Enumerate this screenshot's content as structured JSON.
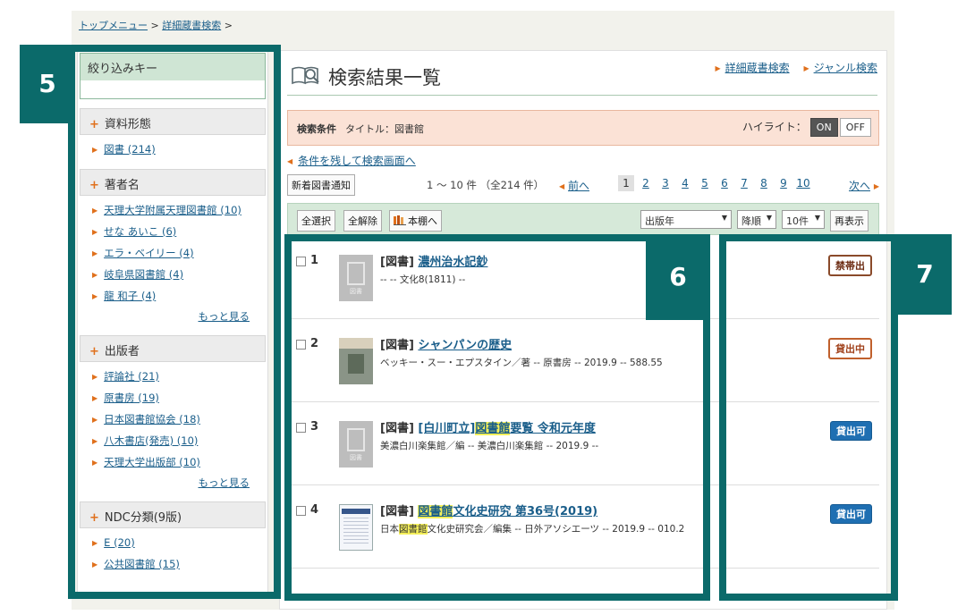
{
  "breadcrumb": {
    "top": "トップメニュー",
    "sep": ">",
    "detail": "詳細蔵書検索",
    "sep2": ">"
  },
  "sidebar": {
    "key_title": "絞り込みキー",
    "facets": [
      {
        "title": "資料形態",
        "items": [
          "図書 (214)"
        ]
      },
      {
        "title": "著者名",
        "items": [
          "天理大学附属天理図書館 (10)",
          "せな あいこ (6)",
          "エラ・ベイリー (4)",
          "岐阜県図書館 (4)",
          "龍 和子 (4)"
        ],
        "more": "もっと見る"
      },
      {
        "title": "出版者",
        "items": [
          "評論社 (21)",
          "原書房 (19)",
          "日本図書館協会 (18)",
          "八木書店(発売) (10)",
          "天理大学出版部 (10)"
        ],
        "more": "もっと見る"
      },
      {
        "title": "NDC分類(9版)",
        "items": [
          "E (20)",
          "公共図書館 (15)"
        ]
      }
    ]
  },
  "main": {
    "title": "検索結果一覧",
    "links": [
      "詳細蔵書検索",
      "ジャンル検索"
    ],
    "condition": {
      "label": "検索条件",
      "value": "タイトル：図書館",
      "highlight_label": "ハイライト：",
      "on": "ON",
      "off": "OFF"
    },
    "back_link": "条件を残して検索画面へ",
    "new_arrival_button": "新着図書通知",
    "count": "1 ～ 10 件 （全214 件）",
    "prev": "前へ",
    "pages": [
      "1",
      "2",
      "3",
      "4",
      "5",
      "6",
      "7",
      "8",
      "9",
      "10"
    ],
    "current_page": "1",
    "next": "次へ",
    "toolbar": {
      "select_all": "全選択",
      "deselect_all": "全解除",
      "shelf": "本棚へ",
      "sort_field": "出版年",
      "sort_order": "降順",
      "per_page": "10件",
      "redisplay": "再表示"
    },
    "results": [
      {
        "num": "1",
        "type": "[図書]",
        "title_parts": [
          {
            "t": "濃州治水記鈔",
            "hl": false
          }
        ],
        "meta": "-- -- 文化8(1811) --",
        "thumb": "図書",
        "status": "禁帯出",
        "status_kind": "ban"
      },
      {
        "num": "2",
        "type": "[図書]",
        "title_parts": [
          {
            "t": "シャンパンの歴史",
            "hl": false
          }
        ],
        "meta": "ベッキー・スー・エプスタイン／著 -- 原書房 -- 2019.9 -- 588.55",
        "thumb": "",
        "status": "貸出中",
        "status_kind": "out"
      },
      {
        "num": "3",
        "type": "[図書]",
        "title_parts": [
          {
            "t": "[白川町立]",
            "hl": false
          },
          {
            "t": "図書館",
            "hl": true
          },
          {
            "t": "要覧 令和元年度",
            "hl": false
          }
        ],
        "meta": "美濃白川楽集館／編 -- 美濃白川楽集館 -- 2019.9 --",
        "thumb": "図書",
        "status": "貸出可",
        "status_kind": "ok"
      },
      {
        "num": "4",
        "type": "[図書]",
        "title_parts": [
          {
            "t": "図書館",
            "hl": true
          },
          {
            "t": "文化史研究 第36号(2019)",
            "hl": false
          }
        ],
        "meta_parts": [
          {
            "t": "日本",
            "hl": false
          },
          {
            "t": "図書館",
            "hl": true
          },
          {
            "t": "文化史研究会／編集 -- 日外アソシエーツ -- 2019.9 -- 010.2",
            "hl": false
          }
        ],
        "thumb": "",
        "status": "貸出可",
        "status_kind": "ok"
      }
    ]
  },
  "callouts": [
    "5",
    "6",
    "7"
  ],
  "colors": {
    "frame": "#0b6a6a",
    "accent": "#e0701c",
    "link": "#1a5e8a",
    "highlight": "#f5f05a"
  }
}
